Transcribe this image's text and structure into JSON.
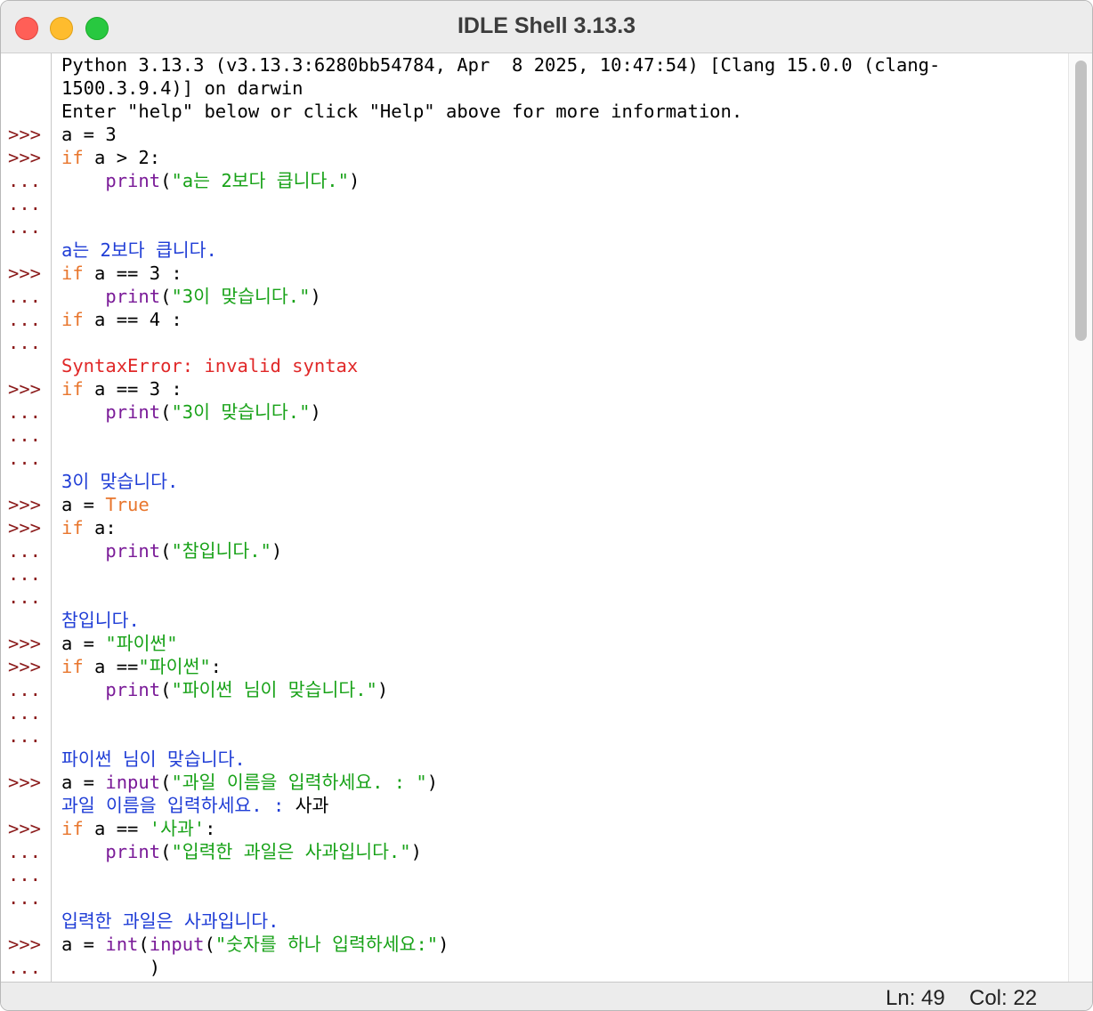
{
  "window": {
    "title": "IDLE Shell 3.13.3"
  },
  "status": {
    "ln": "Ln: 49",
    "col": "Col: 22"
  },
  "prompts": [
    "",
    "",
    "",
    ">>>",
    ">>>",
    "...",
    "...",
    "...",
    "",
    ">>>",
    "...",
    "...",
    "...",
    "",
    ">>>",
    "...",
    "...",
    "...",
    "",
    ">>>",
    ">>>",
    "...",
    "...",
    "...",
    "",
    ">>>",
    ">>>",
    "...",
    "...",
    "...",
    "",
    ">>>",
    "",
    ">>>",
    "...",
    "...",
    "...",
    "",
    ">>>",
    "..."
  ],
  "lines": [
    [
      [
        "Python 3.13.3 (v3.13.3:6280bb54784, Apr  8 2025, 10:47:54) [Clang 15.0.0 (clang-",
        ""
      ]
    ],
    [
      [
        "1500.3.9.4)] on darwin",
        ""
      ]
    ],
    [
      [
        "Enter \"help\" below or click \"Help\" above for more information.",
        ""
      ]
    ],
    [
      [
        "a = 3",
        ""
      ]
    ],
    [
      [
        "if",
        "kw"
      ],
      [
        " a > 2:",
        ""
      ]
    ],
    [
      [
        "    ",
        ""
      ],
      [
        "print",
        "bi"
      ],
      [
        "(",
        ""
      ],
      [
        "\"a는 2보다 큽니다.\"",
        "str"
      ],
      [
        ")",
        ""
      ]
    ],
    [],
    [],
    [
      [
        "a는 2보다 큽니다.",
        "out"
      ]
    ],
    [
      [
        "if",
        "kw"
      ],
      [
        " a == 3 :",
        ""
      ]
    ],
    [
      [
        "    ",
        ""
      ],
      [
        "print",
        "bi"
      ],
      [
        "(",
        ""
      ],
      [
        "\"3이 맞습니다.\"",
        "str"
      ],
      [
        ")",
        ""
      ]
    ],
    [
      [
        "if",
        "kw"
      ],
      [
        " a == 4 :",
        ""
      ]
    ],
    [],
    [
      [
        "SyntaxError: invalid syntax",
        "err"
      ]
    ],
    [
      [
        "if",
        "kw"
      ],
      [
        " a == 3 :",
        ""
      ]
    ],
    [
      [
        "    ",
        ""
      ],
      [
        "print",
        "bi"
      ],
      [
        "(",
        ""
      ],
      [
        "\"3이 맞습니다.\"",
        "str"
      ],
      [
        ")",
        ""
      ]
    ],
    [],
    [],
    [
      [
        "3이 맞습니다.",
        "out"
      ]
    ],
    [
      [
        "a = ",
        ""
      ],
      [
        "True",
        "kw"
      ]
    ],
    [
      [
        "if",
        "kw"
      ],
      [
        " a:",
        ""
      ]
    ],
    [
      [
        "    ",
        ""
      ],
      [
        "print",
        "bi"
      ],
      [
        "(",
        ""
      ],
      [
        "\"참입니다.\"",
        "str"
      ],
      [
        ")",
        ""
      ]
    ],
    [],
    [],
    [
      [
        "참입니다.",
        "out"
      ]
    ],
    [
      [
        "a = ",
        ""
      ],
      [
        "\"파이썬\"",
        "str"
      ]
    ],
    [
      [
        "if",
        "kw"
      ],
      [
        " a ==",
        ""
      ],
      [
        "\"파이썬\"",
        "str"
      ],
      [
        ":",
        ""
      ]
    ],
    [
      [
        "    ",
        ""
      ],
      [
        "print",
        "bi"
      ],
      [
        "(",
        ""
      ],
      [
        "\"파이썬 님이 맞습니다.\"",
        "str"
      ],
      [
        ")",
        ""
      ]
    ],
    [],
    [],
    [
      [
        "파이썬 님이 맞습니다.",
        "out"
      ]
    ],
    [
      [
        "a = ",
        ""
      ],
      [
        "input",
        "bi"
      ],
      [
        "(",
        ""
      ],
      [
        "\"과일 이름을 입력하세요. : \"",
        "str"
      ],
      [
        ")",
        ""
      ]
    ],
    [
      [
        "과일 이름을 입력하세요. : ",
        "out"
      ],
      [
        "사과",
        ""
      ]
    ],
    [
      [
        "if",
        "kw"
      ],
      [
        " a == ",
        ""
      ],
      [
        "'사과'",
        "str"
      ],
      [
        ":",
        ""
      ]
    ],
    [
      [
        "    ",
        ""
      ],
      [
        "print",
        "bi"
      ],
      [
        "(",
        ""
      ],
      [
        "\"입력한 과일은 사과입니다.\"",
        "str"
      ],
      [
        ")",
        ""
      ]
    ],
    [],
    [],
    [
      [
        "입력한 과일은 사과입니다.",
        "out"
      ]
    ],
    [
      [
        "a = ",
        ""
      ],
      [
        "int",
        "bi"
      ],
      [
        "(",
        ""
      ],
      [
        "input",
        "bi"
      ],
      [
        "(",
        ""
      ],
      [
        "\"숫자를 하나 입력하세요:\"",
        "str"
      ],
      [
        ")",
        ""
      ]
    ],
    [
      [
        "        )",
        ""
      ]
    ]
  ]
}
